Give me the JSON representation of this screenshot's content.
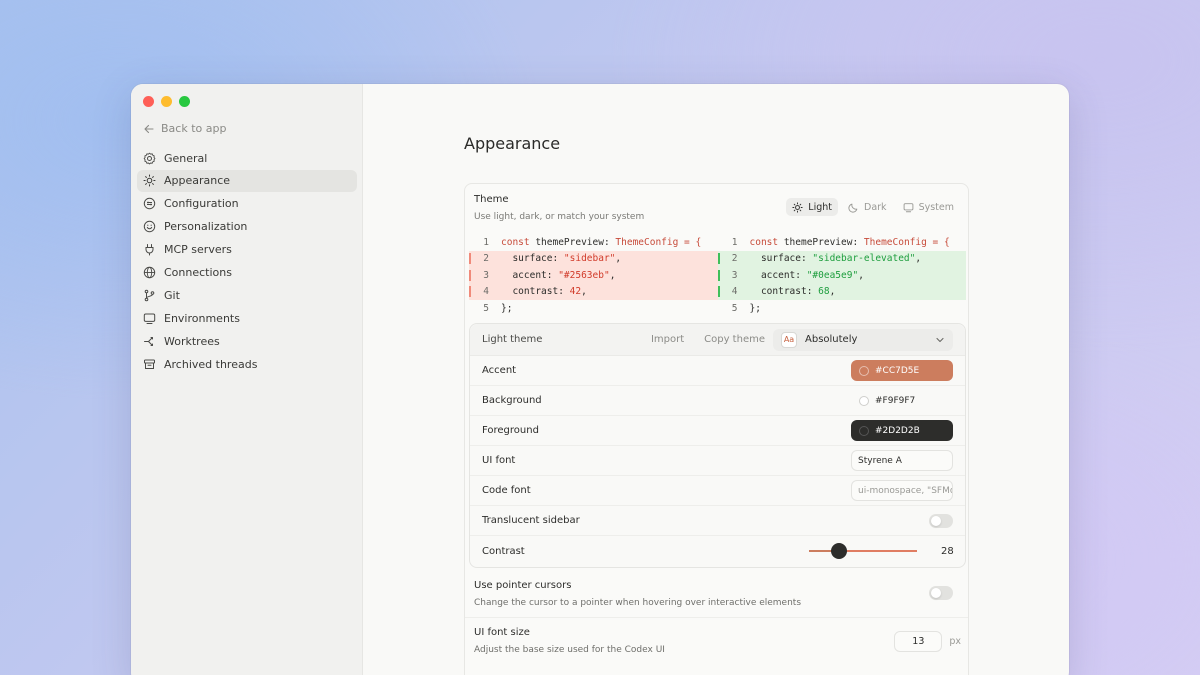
{
  "sidebar": {
    "back_label": "Back to app",
    "items": [
      {
        "label": "General",
        "icon": "gear-icon"
      },
      {
        "label": "Appearance",
        "icon": "sun-icon",
        "active": true
      },
      {
        "label": "Configuration",
        "icon": "sliders-icon"
      },
      {
        "label": "Personalization",
        "icon": "smile-icon"
      },
      {
        "label": "MCP servers",
        "icon": "plug-icon"
      },
      {
        "label": "Connections",
        "icon": "globe-icon"
      },
      {
        "label": "Git",
        "icon": "git-branch-icon"
      },
      {
        "label": "Environments",
        "icon": "monitor-icon"
      },
      {
        "label": "Worktrees",
        "icon": "fork-icon"
      },
      {
        "label": "Archived threads",
        "icon": "archive-icon"
      }
    ]
  },
  "main": {
    "title": "Appearance",
    "theme": {
      "title": "Theme",
      "description": "Use light, dark, or match your system",
      "modes": [
        {
          "label": "Light",
          "icon": "sun-icon",
          "active": true
        },
        {
          "label": "Dark",
          "icon": "moon-icon"
        },
        {
          "label": "System",
          "icon": "monitor-icon"
        }
      ]
    },
    "diff": {
      "left": {
        "l1_num": "1",
        "l1_kw": "const",
        "l1_name": " themePreview: ",
        "l1_type": "ThemeConfig",
        "l1_rest": " = {",
        "l2_num": "2",
        "l2_key": "  surface: ",
        "l2_val": "\"sidebar\"",
        "l2_end": ",",
        "l3_num": "3",
        "l3_key": "  accent: ",
        "l3_val": "\"#2563eb\"",
        "l3_end": ",",
        "l4_num": "4",
        "l4_key": "  contrast: ",
        "l4_val": "42",
        "l4_end": ",",
        "l5_num": "5",
        "l5_text": "};"
      },
      "right": {
        "l1_num": "1",
        "l1_kw": "const",
        "l1_name": " themePreview: ",
        "l1_type": "ThemeConfig",
        "l1_rest": " = {",
        "l2_num": "2",
        "l2_key": "  surface: ",
        "l2_val": "\"sidebar-elevated\"",
        "l2_end": ",",
        "l3_num": "3",
        "l3_key": "  accent: ",
        "l3_val": "\"#0ea5e9\"",
        "l3_end": ",",
        "l4_num": "4",
        "l4_key": "  contrast: ",
        "l4_val": "68",
        "l4_end": ",",
        "l5_num": "5",
        "l5_text": "};"
      }
    },
    "light_theme": {
      "title": "Light theme",
      "import_label": "Import",
      "copy_label": "Copy theme",
      "font_badge": "Aa",
      "font_value": "Absolutely",
      "accent": {
        "label": "Accent",
        "value": "#CC7D5E",
        "color": "#CC7D5E"
      },
      "background": {
        "label": "Background",
        "value": "#F9F9F7",
        "color": "#F9F9F7"
      },
      "foreground": {
        "label": "Foreground",
        "value": "#2D2D2B",
        "color": "#2D2D2B"
      },
      "ui_font": {
        "label": "UI font",
        "value": "Styrene A"
      },
      "code_font": {
        "label": "Code font",
        "placeholder": "ui-monospace, \"SFMono-Regular\""
      },
      "translucent": {
        "label": "Translucent sidebar",
        "on": false
      },
      "contrast": {
        "label": "Contrast",
        "value": "28",
        "fraction": 0.28
      }
    },
    "pointer": {
      "title": "Use pointer cursors",
      "description": "Change the cursor to a pointer when hovering over interactive elements",
      "on": false
    },
    "font_size": {
      "title": "UI font size",
      "description": "Adjust the base size used for the Codex UI",
      "value": "13",
      "unit": "px"
    }
  }
}
